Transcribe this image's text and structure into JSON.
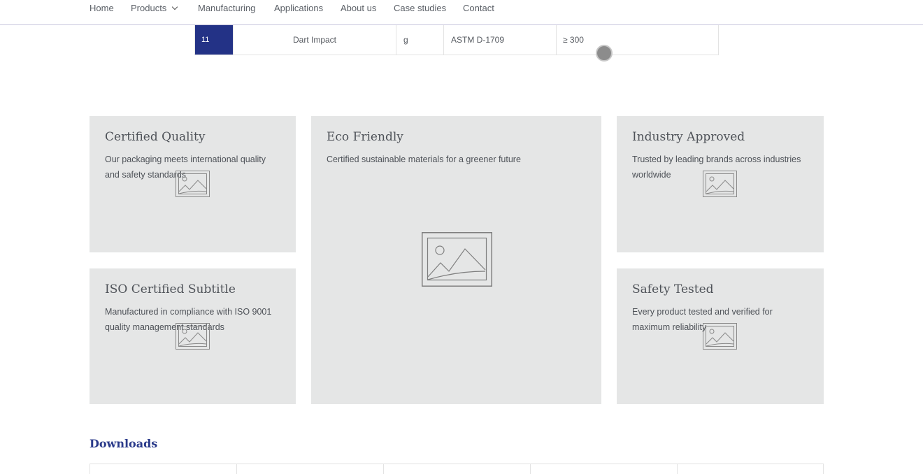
{
  "nav": {
    "items": [
      "Home",
      "Products",
      "Manufacturing",
      "Applications",
      "About us",
      "Case studies",
      "Contact"
    ]
  },
  "spec_row": {
    "number": "11",
    "property": "Dart Impact",
    "unit": "g",
    "method": "ASTM D-1709",
    "value": "≥ 300"
  },
  "cards": [
    {
      "title": "Certified Quality",
      "text": "Our packaging meets international quality and safety standards"
    },
    {
      "title": "Eco Friendly",
      "text": "Certified sustainable materials for a greener future"
    },
    {
      "title": "Industry Approved",
      "text": "Trusted by leading brands across industries worldwide"
    },
    {
      "title": "ISO Certified Subtitle",
      "text": "Manufactured in compliance with ISO 9001 quality management standards"
    },
    {
      "title": "Safety Tested",
      "text": "Every product tested and verified for maximum reliability"
    }
  ],
  "downloads": {
    "title": "Downloads"
  },
  "icons": {
    "placeholder": "image-placeholder-icon"
  },
  "colors": {
    "accent": "#233286",
    "card_bg": "#e5e6e6",
    "heading_blue": "#2a3a8a"
  }
}
